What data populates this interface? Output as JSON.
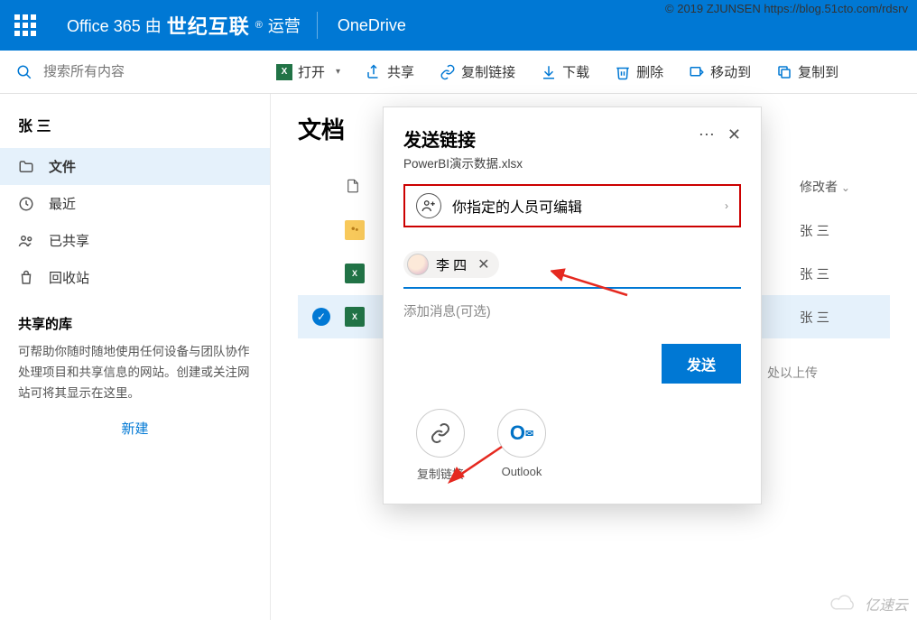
{
  "copyright": "© 2019 ZJUNSEN https://blog.51cto.com/rdsrv",
  "watermark": "亿速云",
  "top": {
    "brand_prefix": "Office 365 由",
    "brand_strong": "世纪互联",
    "brand_suffix": "运营",
    "app": "OneDrive"
  },
  "search": {
    "placeholder": "搜索所有内容"
  },
  "cmd": {
    "open": "打开",
    "share": "共享",
    "copylink": "复制链接",
    "download": "下载",
    "delete": "删除",
    "moveto": "移动到",
    "copyto": "复制到"
  },
  "sidebar": {
    "user": "张 三",
    "items": [
      {
        "label": "文件",
        "icon": "folder"
      },
      {
        "label": "最近",
        "icon": "recent"
      },
      {
        "label": "已共享",
        "icon": "shared"
      },
      {
        "label": "回收站",
        "icon": "recycle"
      }
    ],
    "lib_head": "共享的库",
    "lib_desc": "可帮助你随时随地使用任何设备与团队协作处理项目和共享信息的网站。创建或关注网站可将其显示在这里。",
    "new": "新建"
  },
  "main": {
    "title": "文档",
    "columns": {
      "modified": "修改者"
    },
    "rows": [
      {
        "type": "folder-shared",
        "modifier": "张 三"
      },
      {
        "type": "xlsx",
        "modifier": "张 三"
      },
      {
        "type": "xlsx",
        "modifier": "张 三",
        "selected": true
      }
    ],
    "dropzone": "处以上传"
  },
  "dialog": {
    "title": "发送链接",
    "subtitle": "PowerBI演示数据.xlsx",
    "permission": "你指定的人员可编辑",
    "chip_name": "李 四",
    "msg_placeholder": "添加消息(可选)",
    "send": "发送",
    "opt_copy": "复制链接",
    "opt_outlook": "Outlook"
  }
}
